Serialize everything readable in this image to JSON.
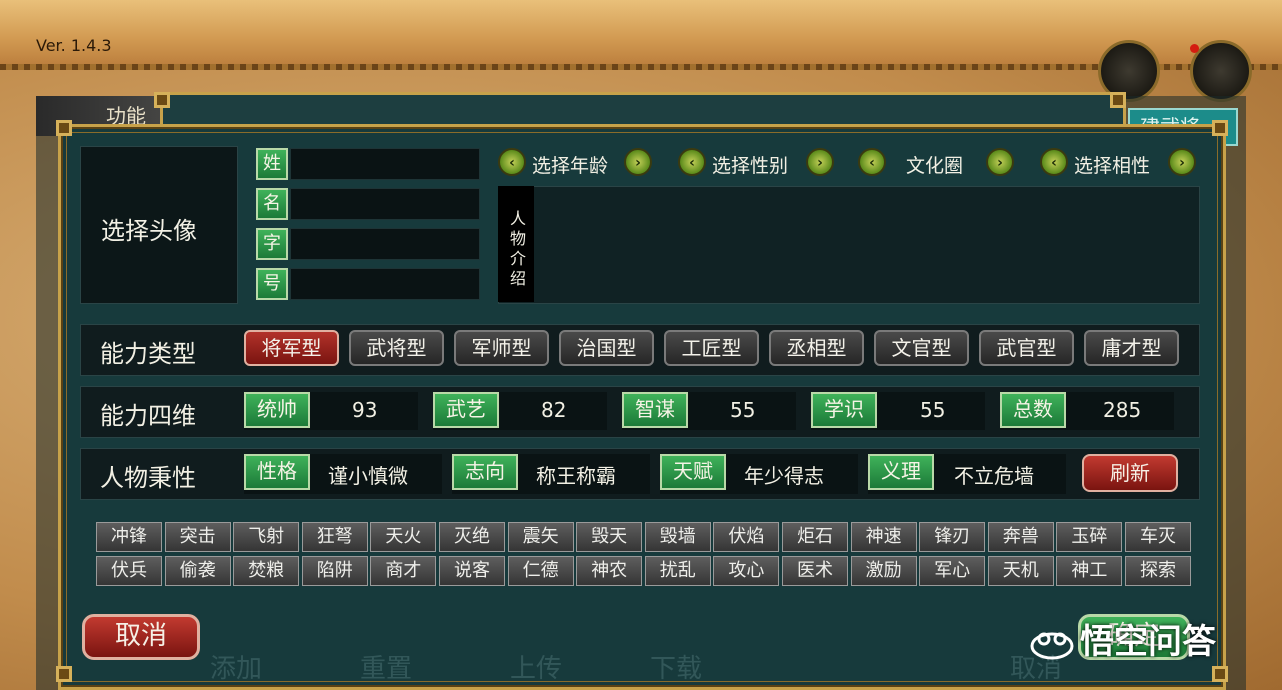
{
  "app": {
    "version": "Ver. 1.4.3"
  },
  "background": {
    "left_tab": "功能",
    "right_tab": "建武将",
    "ghost_buttons": [
      "添加",
      "重置",
      "上传",
      "下载",
      "取消"
    ]
  },
  "dialog": {
    "avatar_label": "选择头像",
    "name_fields": [
      {
        "tag": "姓",
        "value": ""
      },
      {
        "tag": "名",
        "value": ""
      },
      {
        "tag": "字",
        "value": ""
      },
      {
        "tag": "号",
        "value": ""
      }
    ],
    "selectors": [
      {
        "label": "选择年龄"
      },
      {
        "label": "选择性别"
      },
      {
        "label": "文化圈"
      },
      {
        "label": "选择相性"
      }
    ],
    "bio_label": "人物介绍",
    "bio_text": "",
    "ability_type": {
      "title": "能力类型",
      "options": [
        "将军型",
        "武将型",
        "军师型",
        "治国型",
        "工匠型",
        "丞相型",
        "文官型",
        "武官型",
        "庸才型"
      ],
      "selected": "将军型"
    },
    "stats": {
      "title": "能力四维",
      "items": [
        {
          "label": "统帅",
          "value": "93"
        },
        {
          "label": "武艺",
          "value": "82"
        },
        {
          "label": "智谋",
          "value": "55"
        },
        {
          "label": "学识",
          "value": "55"
        },
        {
          "label": "总数",
          "value": "285"
        }
      ]
    },
    "traits": {
      "title": "人物秉性",
      "items": [
        {
          "label": "性格",
          "value": "谨小慎微"
        },
        {
          "label": "志向",
          "value": "称王称霸"
        },
        {
          "label": "天赋",
          "value": "年少得志"
        },
        {
          "label": "义理",
          "value": "不立危墙"
        }
      ],
      "refresh": "刷新"
    },
    "skills_row1": [
      "冲锋",
      "突击",
      "飞射",
      "狂弩",
      "天火",
      "灭绝",
      "震矢",
      "毁天",
      "毁墙",
      "伏焰",
      "炬石",
      "神速",
      "锋刃",
      "奔兽",
      "玉碎",
      "车灭"
    ],
    "skills_row2": [
      "伏兵",
      "偷袭",
      "焚粮",
      "陷阱",
      "商才",
      "说客",
      "仁德",
      "神农",
      "扰乱",
      "攻心",
      "医术",
      "激励",
      "军心",
      "天机",
      "神工",
      "探索"
    ],
    "cancel": "取消",
    "ok": "确定"
  },
  "watermark": "悟空问答"
}
